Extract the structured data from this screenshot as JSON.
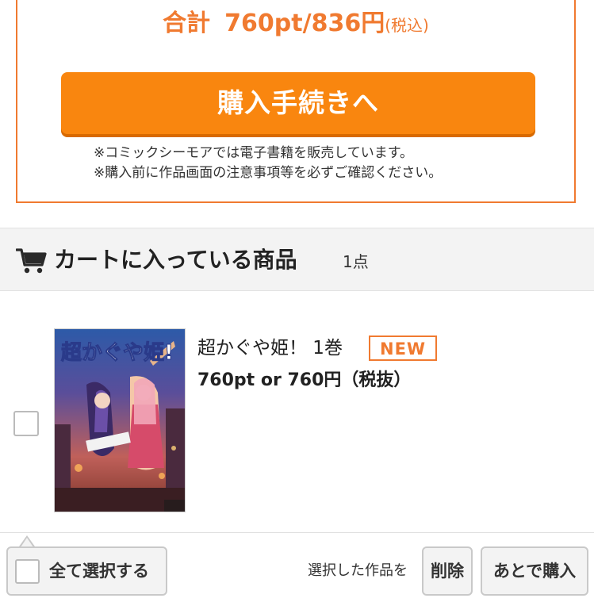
{
  "summary": {
    "total_label": "合計",
    "total_value": "760pt/836円",
    "tax_note": "(税込)",
    "checkout_button": "購入手続きへ",
    "notices": [
      "※コミックシーモアでは電子書籍を販売しています。",
      "※購入前に作品画面の注意事項等を必ずご確認ください。"
    ]
  },
  "cart": {
    "title": "カートに入っている商品",
    "count": "1点",
    "items": [
      {
        "title": "超かぐや姫！ 1巻",
        "badge": "NEW",
        "price": "760pt or 760円（税抜）",
        "cover_title": "超かぐや姫!"
      }
    ]
  },
  "bottom": {
    "select_all": "全て選択する",
    "selected_label": "選択した作品を",
    "delete_button": "削除",
    "later_button": "あとで購入"
  },
  "colors": {
    "accent": "#f07a30",
    "button": "#f9860f"
  }
}
